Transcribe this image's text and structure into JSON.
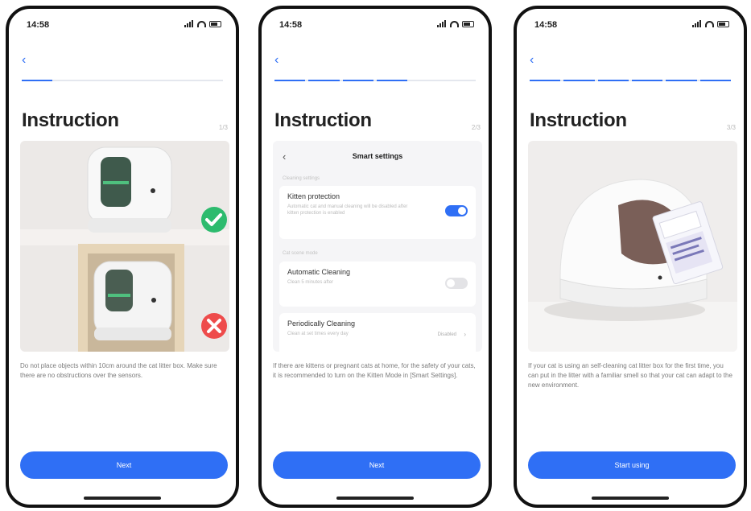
{
  "status": {
    "time": "14:58"
  },
  "colors": {
    "accent": "#2f6ff5",
    "track": "#e4e7ee",
    "ok": "#2dbb6e",
    "bad": "#ee4b4b"
  },
  "screens": [
    {
      "back_icon": "chevron-left-icon",
      "progress": {
        "total": 6,
        "done": 1
      },
      "title": "Instruction",
      "page_indicator": "1/3",
      "description": "Do not place objects within 10cm around the cat litter box. Make sure there are no obstructions over the sensors.",
      "button": "Next"
    },
    {
      "back_icon": "chevron-left-icon",
      "progress": {
        "total": 6,
        "done": 4
      },
      "title": "Instruction",
      "page_indicator": "2/3",
      "settings": {
        "title": "Smart settings",
        "section1": "Cleaning settings",
        "kitten_title": "Kitten protection",
        "kitten_desc": "Automatic cat and manual cleaning will be disabled after kitten protection is enabled",
        "kitten_on": true,
        "section2": "Cat scene mode",
        "auto_title": "Automatic Cleaning",
        "auto_desc": "Clean 5 minutes after",
        "auto_on": false,
        "periodic_title": "Periodically Cleaning",
        "periodic_desc": "Clean at set times every day",
        "periodic_value": "Disabled"
      },
      "description": "If there are kittens or pregnant cats at home, for the safety of your cats, it is recommended to turn on the Kitten Mode in [Smart Settings].",
      "button": "Next"
    },
    {
      "back_icon": "chevron-left-icon",
      "progress": {
        "total": 6,
        "done": 6
      },
      "title": "Instruction",
      "page_indicator": "3/3",
      "description": "If your cat is using an self-cleaning cat litter box for the first time, you can put in the litter with a familiar smell so that your cat can adapt to the new environment.",
      "button": "Start using"
    }
  ]
}
